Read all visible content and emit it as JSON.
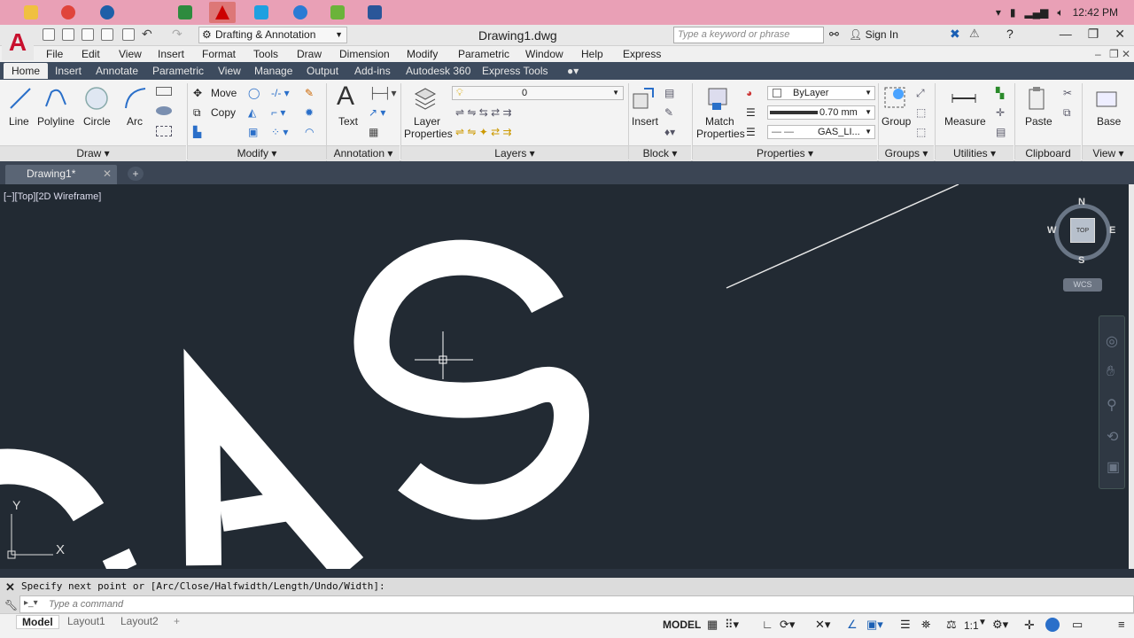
{
  "taskbar": {
    "clock": "12:42 PM",
    "apps": [
      "file-explorer",
      "chrome",
      "media",
      "control",
      "pdf",
      "skype",
      "ie",
      "utorrent",
      "word"
    ]
  },
  "titlebar": {
    "workspace": "Drafting & Annotation",
    "document": "Drawing1.dwg",
    "search_placeholder": "Type a keyword or phrase",
    "signin": "Sign In"
  },
  "menubar": [
    "File",
    "Edit",
    "View",
    "Insert",
    "Format",
    "Tools",
    "Draw",
    "Dimension",
    "Modify",
    "Parametric",
    "Window",
    "Help",
    "Express"
  ],
  "ribbon_tabs": [
    "Home",
    "Insert",
    "Annotate",
    "Parametric",
    "View",
    "Manage",
    "Output",
    "Add-ins",
    "Autodesk 360",
    "Express Tools"
  ],
  "ribbon": {
    "draw": {
      "line": "Line",
      "polyline": "Polyline",
      "circle": "Circle",
      "arc": "Arc",
      "panel": "Draw"
    },
    "modify": {
      "move": "Move",
      "copy": "Copy",
      "panel": "Modify"
    },
    "annotation": {
      "text": "Text",
      "panel": "Annotation"
    },
    "layers": {
      "layer_props": "Layer",
      "layer_props2": "Properties",
      "current_layer": "0",
      "panel": "Layers"
    },
    "block": {
      "insert": "Insert",
      "panel": "Block"
    },
    "properties": {
      "match": "Match",
      "match2": "Properties",
      "color": "ByLayer",
      "lineweight": "0.70 mm",
      "linetype": "GAS_LI...",
      "panel": "Properties"
    },
    "groups": {
      "group": "Group",
      "panel": "Groups"
    },
    "utilities": {
      "measure": "Measure",
      "panel": "Utilities"
    },
    "clipboard": {
      "paste": "Paste",
      "panel": "Clipboard"
    },
    "view": {
      "base": "Base",
      "panel": "View"
    }
  },
  "filetab": {
    "name": "Drawing1*"
  },
  "viewport": {
    "label": "[−][Top][2D Wireframe]"
  },
  "viewcube": {
    "n": "N",
    "s": "S",
    "e": "E",
    "w": "W",
    "top": "TOP",
    "wcs": "WCS"
  },
  "ucs": {
    "y": "Y",
    "x": "X"
  },
  "command": {
    "history": "Specify next point or [Arc/Close/Halfwidth/Length/Undo/Width]:",
    "placeholder": "Type a command"
  },
  "layout_tabs": [
    "Model",
    "Layout1",
    "Layout2"
  ],
  "status": {
    "model": "MODEL",
    "scale": "1:1"
  },
  "colors": {
    "canvas": "#222a33",
    "ribbon_tabs": "#3d4b5e",
    "taskbar": "#e9a0b6"
  }
}
